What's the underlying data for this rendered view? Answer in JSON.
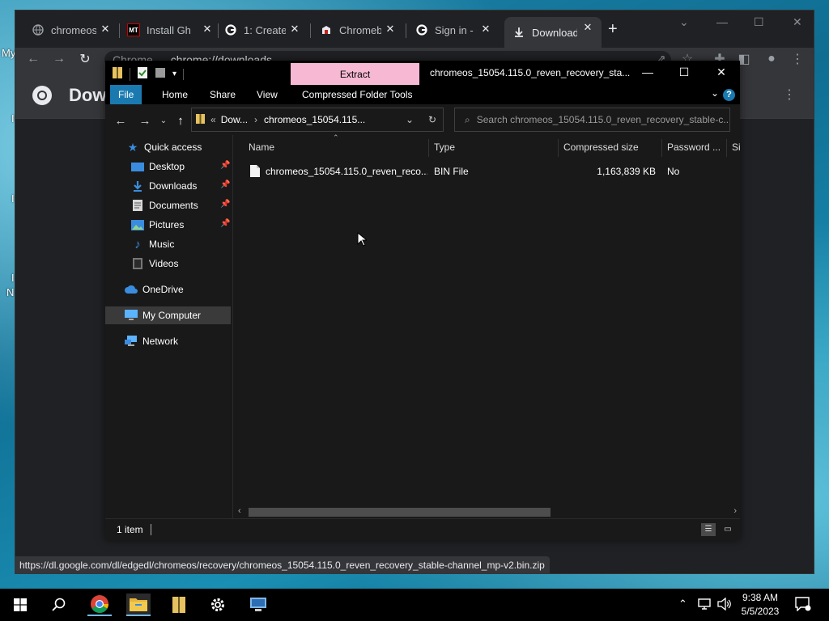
{
  "desktop": {
    "label_top": "My",
    "label_left_1": "I",
    "label_left_2": "I",
    "label_left_3": "I",
    "label_left_4": "N"
  },
  "browser": {
    "tabs": [
      {
        "label": "chromeos",
        "close": "✕"
      },
      {
        "label": "Install Gh",
        "close": "✕"
      },
      {
        "label": "1: Create",
        "close": "✕"
      },
      {
        "label": "Chromeb",
        "close": "✕"
      },
      {
        "label": "Sign in - C",
        "close": "✕"
      },
      {
        "label": "Downloads",
        "close": "✕"
      }
    ],
    "new_tab": "+",
    "omnibox_chip": "Chrome",
    "url": "chrome://downloads",
    "page_title": "Dow",
    "status_url": "https://dl.google.com/dl/edgedl/chromeos/recovery/chromeos_15054.115.0_reven_recovery_stable-channel_mp-v2.bin.zip"
  },
  "explorer": {
    "context_tab": "Extract",
    "window_title": "chromeos_15054.115.0_reven_recovery_sta...",
    "ribbon_tabs": [
      "File",
      "Home",
      "Share",
      "View",
      "Compressed Folder Tools"
    ],
    "help": "?",
    "breadcrumb": {
      "overflow": "«",
      "part1": "Dow...",
      "part2": "chromeos_15054.115..."
    },
    "search_placeholder": "Search chromeos_15054.115.0_reven_recovery_stable-c...",
    "nav": {
      "quick_access": "Quick access",
      "desktop": "Desktop",
      "downloads": "Downloads",
      "documents": "Documents",
      "pictures": "Pictures",
      "music": "Music",
      "videos": "Videos",
      "onedrive": "OneDrive",
      "my_computer": "My Computer",
      "network": "Network"
    },
    "columns": [
      "Name",
      "Type",
      "Compressed size",
      "Password ...",
      "Si"
    ],
    "rows": [
      {
        "name": "chromeos_15054.115.0_reven_reco...",
        "type": "BIN File",
        "size": "1,163,839 KB",
        "password": "No"
      }
    ],
    "status": "1 item"
  },
  "taskbar": {
    "time": "9:38 AM",
    "date": "5/5/2023"
  }
}
